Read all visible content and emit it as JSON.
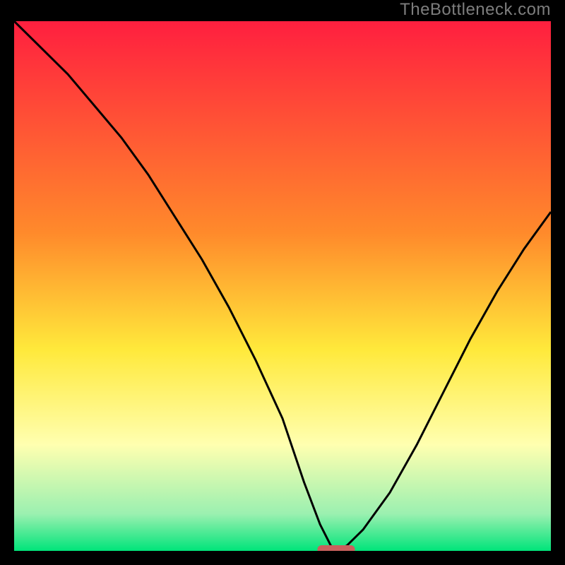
{
  "watermark": "TheBottleneck.com",
  "colors": {
    "bg_black": "#000000",
    "grad_red": "#ff1f3f",
    "grad_orange": "#ff8a2b",
    "grad_yellow": "#ffe93b",
    "grad_pale": "#ffffb0",
    "grad_mint": "#9bf0b0",
    "grad_green": "#00e47a",
    "curve": "#000000",
    "pill": "#c9605d"
  },
  "chart_data": {
    "type": "line",
    "title": "",
    "xlabel": "",
    "ylabel": "",
    "xlim": [
      0,
      100
    ],
    "ylim": [
      0,
      100
    ],
    "x": [
      0,
      5,
      10,
      15,
      20,
      25,
      30,
      35,
      40,
      45,
      50,
      54,
      57,
      59,
      60,
      62,
      65,
      70,
      75,
      80,
      85,
      90,
      95,
      100
    ],
    "values": [
      100,
      95,
      90,
      84,
      78,
      71,
      63,
      55,
      46,
      36,
      25,
      13,
      5,
      1,
      0,
      1,
      4,
      11,
      20,
      30,
      40,
      49,
      57,
      64
    ],
    "minimum_x": 60,
    "minimum_y": 0,
    "pill": {
      "x_start": 56.5,
      "x_end": 63.5,
      "y": 0
    },
    "gradient_stops": [
      {
        "pct": 0,
        "color": "#ff1f3f"
      },
      {
        "pct": 40,
        "color": "#ff8a2b"
      },
      {
        "pct": 62,
        "color": "#ffe93b"
      },
      {
        "pct": 80,
        "color": "#ffffb0"
      },
      {
        "pct": 93,
        "color": "#9bf0b0"
      },
      {
        "pct": 100,
        "color": "#00e47a"
      }
    ]
  }
}
